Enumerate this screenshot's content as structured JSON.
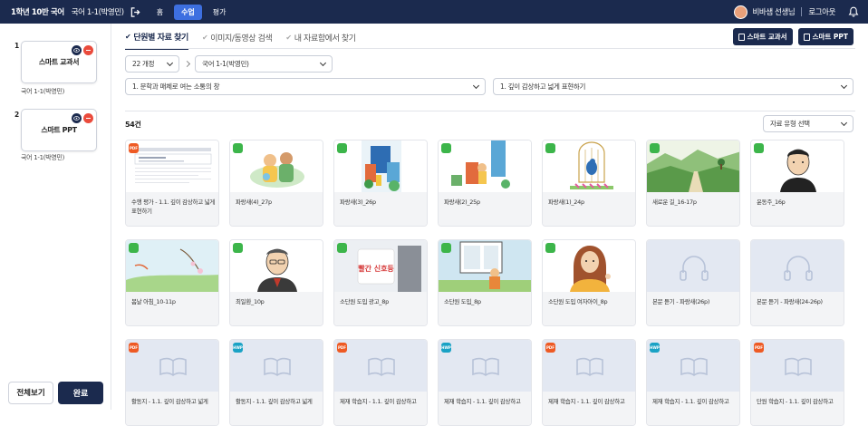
{
  "topbar": {
    "title": "1학년 10반 국어",
    "subject": "국어 1-1(박영민)",
    "menu": [
      {
        "label": "홈"
      },
      {
        "label": "수업",
        "active": true
      },
      {
        "label": "평가"
      }
    ],
    "user": "비바샘 선생님",
    "logout": "로그아웃"
  },
  "sidebar": {
    "items": [
      {
        "num": "1",
        "title": "스마트 교과서",
        "label": "국어 1-1(박영민)"
      },
      {
        "num": "2",
        "title": "스마트 PPT",
        "label": "국어 1-1(박영민)"
      }
    ],
    "view_all": "전체보기",
    "done": "완료"
  },
  "tabs": [
    "단원별 자료 찾기",
    "이미지/동영상 검색",
    "내 자료함에서 찾기"
  ],
  "buttons": {
    "smart_textbook": "스마트 교과서",
    "smart_ppt": "스마트 PPT"
  },
  "filters": {
    "curriculum": "22 개정",
    "book": "국어 1-1(박영민)",
    "unit": "1. 문학과 매체로 여는 소통의 창",
    "subunit": "1. 깊이 감상하고 넓게 표현하기",
    "type": "자료 유형 선택"
  },
  "count": "54건",
  "cards": [
    {
      "badge": "PDF",
      "title": "수행 평가 - 1.1. 깊이 감상하고 넓게 표현하기"
    },
    {
      "badge": "IMG",
      "title": "파랑새(4)_27p"
    },
    {
      "badge": "IMG",
      "title": "파랑새(3)_26p"
    },
    {
      "badge": "IMG",
      "title": "파랑새(2)_25p"
    },
    {
      "badge": "IMG",
      "title": "파랑새(1)_24p"
    },
    {
      "badge": "IMG",
      "title": "새로운 길_16-17p"
    },
    {
      "badge": "IMG",
      "title": "윤동주_16p"
    },
    {
      "badge": "IMG",
      "title": "봄날 아침_10-11p"
    },
    {
      "badge": "IMG",
      "title": "최일환_10p"
    },
    {
      "badge": "IMG",
      "title": "소단원 도입 광고_8p"
    },
    {
      "badge": "IMG",
      "title": "소단원 도입_8p"
    },
    {
      "badge": "IMG",
      "title": "소단원 도입 여자아이_8p"
    },
    {
      "badge": "",
      "title": "본문 듣기 - 파랑새(26p)"
    },
    {
      "badge": "",
      "title": "본문 듣기 - 파랑새(24-26p)"
    },
    {
      "badge": "PDF",
      "title": "활동지 - 1.1. 깊이 감상하고 넓게"
    },
    {
      "badge": "HWP",
      "title": "활동지 - 1.1. 깊이 감상하고 넓게"
    },
    {
      "badge": "PDF",
      "title": "제재 학습지 - 1.1. 깊이 감상하고"
    },
    {
      "badge": "HWP",
      "title": "제재 학습지 - 1.1. 깊이 감상하고"
    },
    {
      "badge": "PDF",
      "title": "제재 학습지 - 1.1. 깊이 감상하고"
    },
    {
      "badge": "HWP",
      "title": "제재 학습지 - 1.1. 깊이 감상하고"
    },
    {
      "badge": "PDF",
      "title": "단원 학습지 - 1.1. 깊이 감상하고"
    }
  ],
  "thumb_text": {
    "ad": "빨간 신호등"
  },
  "colors": {
    "navy": "#1b2a4e",
    "accent": "#3d6fe0",
    "pdf": "#ee5a24",
    "img": "#3cb54a",
    "hwp": "#1aa2c5"
  }
}
